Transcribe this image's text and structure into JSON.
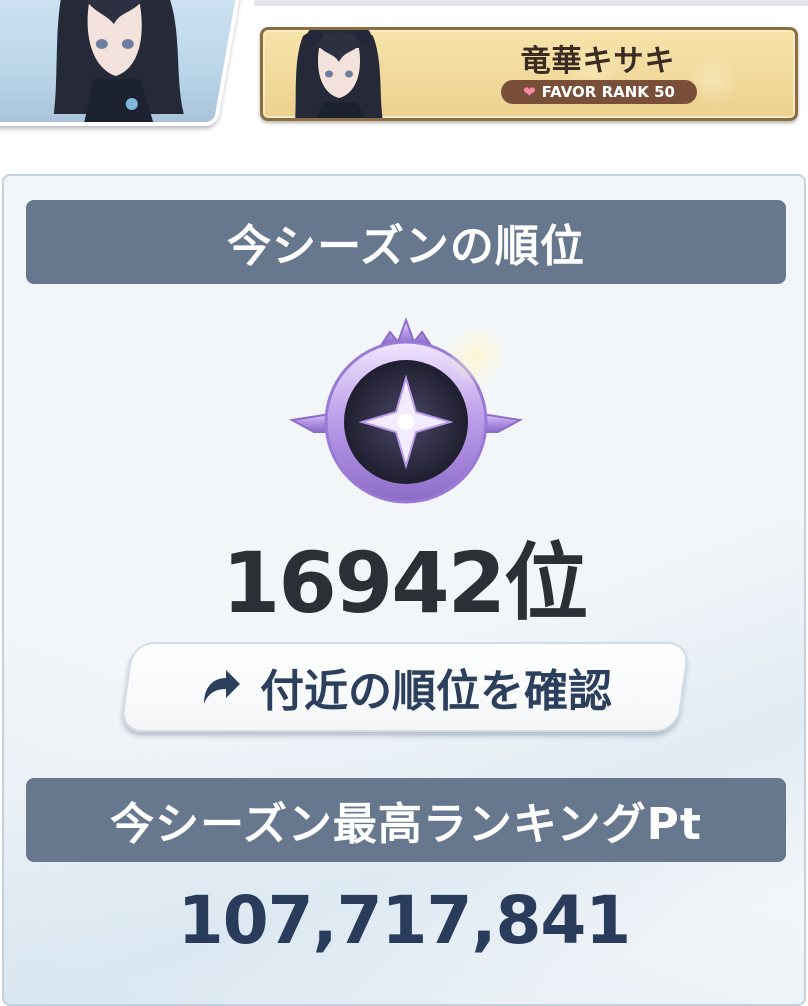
{
  "character": {
    "name": "竜華キサキ",
    "favor_label": "FAVOR RANK 50",
    "favor_icon": "heart-icon"
  },
  "season_rank": {
    "header": "今シーズンの順位",
    "emblem_icon": "rank-emblem-icon",
    "value": "16942位",
    "nearby_button_label": "付近の順位を確認",
    "nearby_button_icon": "share-arrow-icon"
  },
  "best_points": {
    "header": "今シーズン最高ランキングPt",
    "value": "107,717,841"
  },
  "colors": {
    "header_bg": "#67788e",
    "banner_bg": "#f3dca0",
    "favor_pill": "#7a4f3a",
    "rank_text": "#2c2f36",
    "points_text": "#2a3c5c"
  }
}
